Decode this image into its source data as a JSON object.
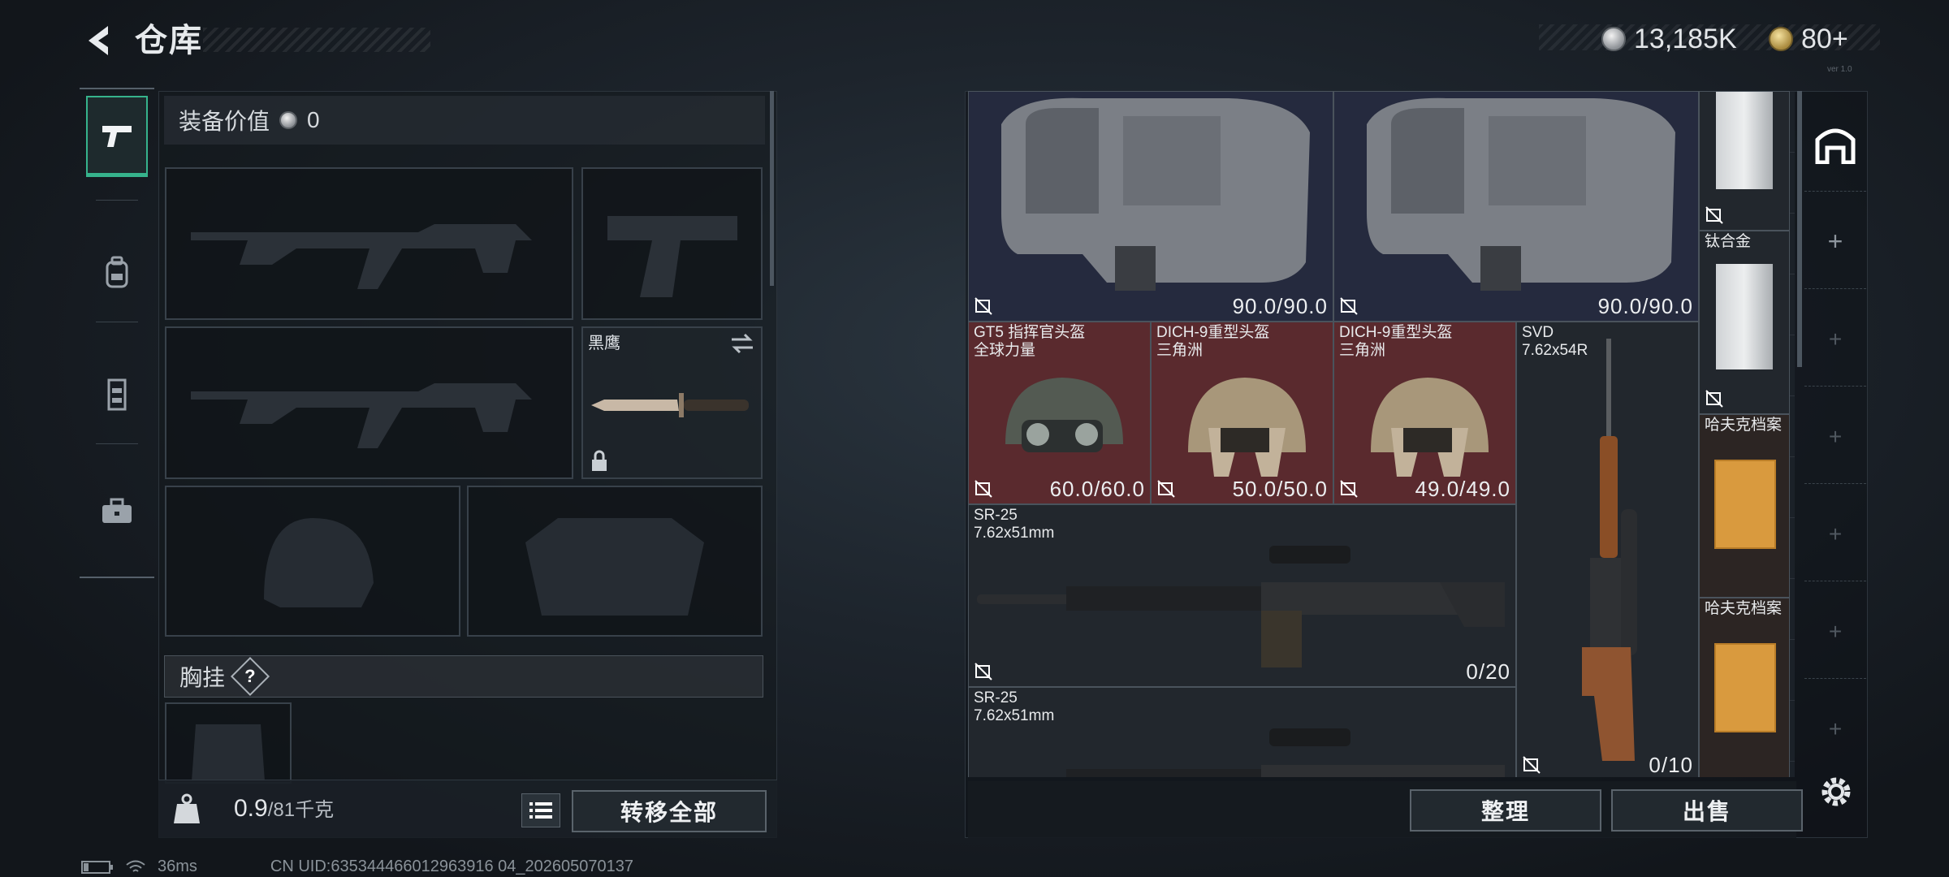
{
  "header": {
    "title": "仓库",
    "currency_silver": "13,185K",
    "currency_gold": "80+",
    "version_tag": "ver 1.0"
  },
  "left": {
    "equip_value_label": "装备价值",
    "equip_value": "0",
    "knife_name": "黑鹰",
    "chest_label": "胸挂",
    "chest_help": "?",
    "weight_value": "0.9",
    "weight_max": "/81千克",
    "transfer_all": "转移全部"
  },
  "stash": {
    "items": [
      {
        "name": "",
        "value": "90.0/90.0"
      },
      {
        "name": "",
        "value": "90.0/90.0"
      },
      {
        "name": "GT5 指挥官头盔",
        "sub": "全球力量",
        "value": "60.0/60.0"
      },
      {
        "name": "DICH-9重型头盔",
        "sub": "三角洲",
        "value": "50.0/50.0"
      },
      {
        "name": "DICH-9重型头盔",
        "sub": "三角洲",
        "value": "49.0/49.0"
      },
      {
        "name": "SVD",
        "sub": "7.62x54R",
        "value": "0/10"
      },
      {
        "name": "SR-25",
        "sub": "7.62x51mm",
        "value": "0/20"
      },
      {
        "name": "SR-25",
        "sub": "7.62x51mm",
        "value": ""
      },
      {
        "name": "钛合金",
        "value": ""
      },
      {
        "name": "哈夫克档案",
        "value": ""
      },
      {
        "name": "哈夫克档案",
        "value": ""
      }
    ],
    "sort_btn": "整理",
    "sell_btn": "出售"
  },
  "status": {
    "ping": "36ms",
    "uid": "CN UID:635344466012963916 04_202605070137"
  },
  "colors": {
    "accent": "#36b38c",
    "armor_bg": "#252a3e",
    "rarity_red": "#5a2a2e"
  }
}
